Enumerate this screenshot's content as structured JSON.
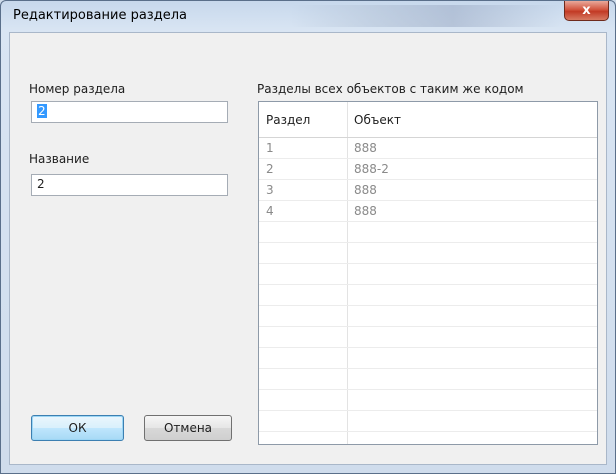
{
  "window": {
    "title": "Редактирование раздела",
    "close_glyph": "x"
  },
  "form": {
    "number_label": "Номер раздела",
    "number_value": "2",
    "name_label": "Название",
    "name_value": "2"
  },
  "grid": {
    "caption": "Разделы всех объектов с таким же кодом",
    "columns": [
      "Раздел",
      "Объект"
    ],
    "rows": [
      [
        "1",
        "888"
      ],
      [
        "2",
        "888-2"
      ],
      [
        "3",
        "888"
      ],
      [
        "4",
        "888"
      ]
    ]
  },
  "buttons": {
    "ok": "ОК",
    "cancel": "Отмена"
  }
}
